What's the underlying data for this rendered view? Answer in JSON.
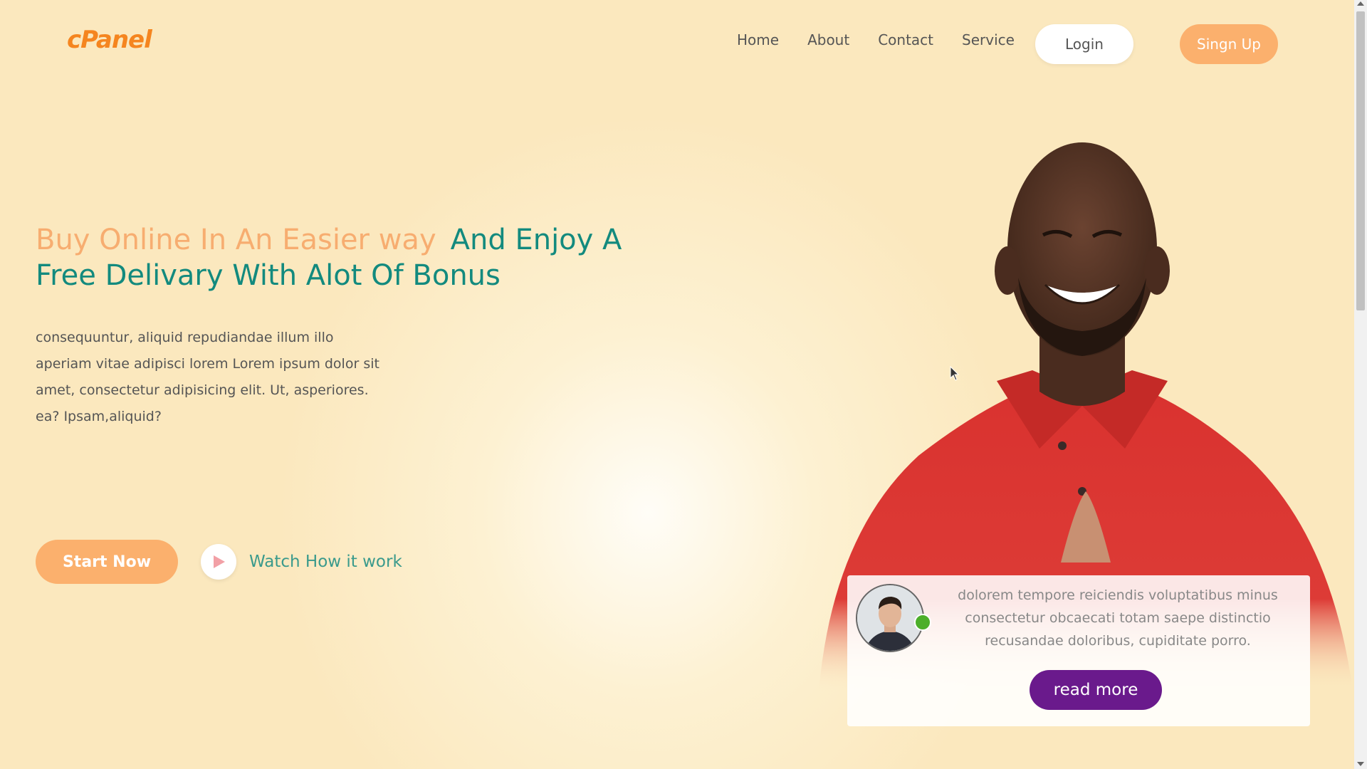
{
  "nav": {
    "logo": "cPanel",
    "links": [
      "Home",
      "About",
      "Contact",
      "Service"
    ],
    "login_label": "Login",
    "signup_label": "Singn Up"
  },
  "hero": {
    "headline_part1": "Buy Online In An Easier way",
    "headline_part2": "And Enjoy A Free Delivary With Alot Of Bonus",
    "paragraph": "consequuntur, aliquid repudiandae illum illo aperiam vitae adipisci lorem Lorem ipsum dolor sit amet, consectetur adipisicing elit. Ut, asperiores. ea? Ipsam,aliquid?",
    "start_label": "Start Now",
    "watch_label": "Watch How it work"
  },
  "card": {
    "text": "dolorem tempore reiciendis voluptatibus minus consectetur obcaecati totam saepe distinctio recusandae doloribus, cupiditate porro.",
    "read_more_label": "read more"
  },
  "colors": {
    "accent_orange": "#fbb06d",
    "logo_orange": "#f5851f",
    "teal": "#138a7e",
    "purple": "#6a1a8c",
    "online_green": "#4caf2a",
    "shirt_red": "#d9322f"
  },
  "icons": {
    "play": "play-icon",
    "online": "online-status-dot",
    "cursor": "mouse-cursor-icon"
  }
}
